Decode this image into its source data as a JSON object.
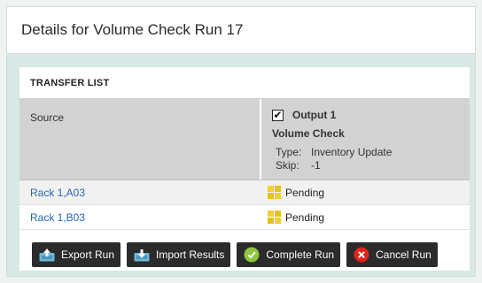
{
  "page": {
    "title": "Details for Volume Check Run 17"
  },
  "transfer_list": {
    "section_label": "TRANSFER LIST",
    "source_header": "Source",
    "output": {
      "checked": true,
      "name": "Output 1",
      "subtitle": "Volume Check",
      "type_label": "Type:",
      "type_value": "Inventory Update",
      "skip_label": "Skip:",
      "skip_value": "-1"
    },
    "rows": [
      {
        "source": "Rack 1,A03",
        "status": "Pending"
      },
      {
        "source": "Rack 1,B03",
        "status": "Pending"
      }
    ]
  },
  "buttons": {
    "export_run": "Export Run",
    "import_results": "Import Results",
    "complete_run": "Complete Run",
    "cancel_run": "Cancel Run"
  },
  "icons": {
    "checkbox_check": "✔",
    "export": "upload-tray-icon",
    "import": "download-tray-icon",
    "complete": "check-circle-icon",
    "cancel": "x-circle-icon",
    "pending": "pending-grid-icon"
  },
  "colors": {
    "link": "#2566b3",
    "pending": "#f0d032",
    "complete_green": "#8dc63f",
    "cancel_red": "#e2231a",
    "button_bg": "#2b2b2b",
    "tray_blue": "#6eb6d8"
  }
}
